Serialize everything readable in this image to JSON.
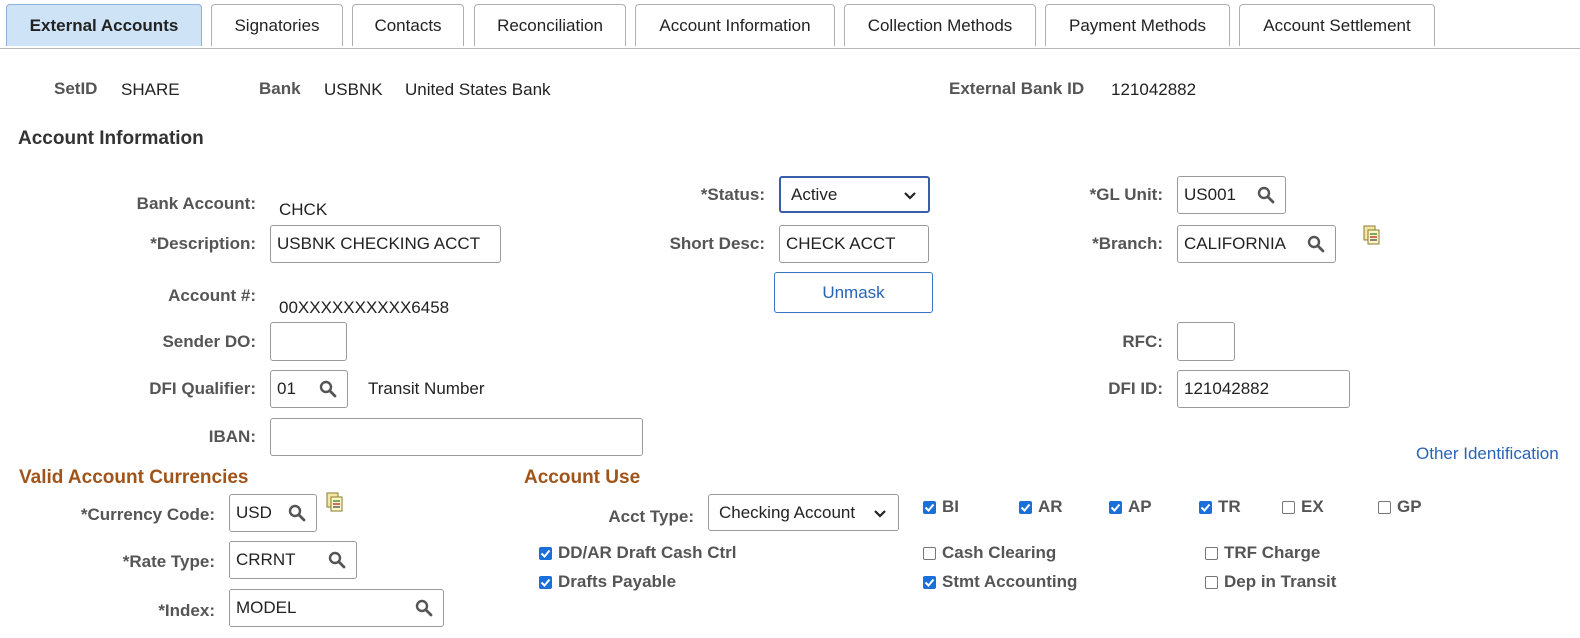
{
  "tabs": [
    {
      "label": "External Accounts",
      "active": true
    },
    {
      "label": "Signatories",
      "active": false
    },
    {
      "label": "Contacts",
      "active": false
    },
    {
      "label": "Reconciliation",
      "active": false
    },
    {
      "label": "Account Information",
      "active": false
    },
    {
      "label": "Collection Methods",
      "active": false
    },
    {
      "label": "Payment Methods",
      "active": false
    },
    {
      "label": "Account Settlement",
      "active": false
    }
  ],
  "header": {
    "setid_label": "SetID",
    "setid_value": "SHARE",
    "bank_label": "Bank",
    "bank_code": "USBNK",
    "bank_name": "United States Bank",
    "ext_bank_id_label": "External Bank ID",
    "ext_bank_id_value": "121042882"
  },
  "account_info": {
    "title": "Account Information",
    "bank_account_label": "Bank Account:",
    "bank_account_value": "CHCK",
    "description_label": "*Description:",
    "description_value": "USBNK CHECKING ACCT",
    "account_num_label": "Account #:",
    "account_num_value": "00XXXXXXXXXX6458",
    "sender_do_label": "Sender DO:",
    "sender_do_value": "",
    "dfi_qualifier_label": "DFI Qualifier:",
    "dfi_qualifier_value": "01",
    "dfi_qualifier_desc": "Transit Number",
    "iban_label": "IBAN:",
    "iban_value": "",
    "status_label": "*Status:",
    "status_value": "Active",
    "short_desc_label": "Short Desc:",
    "short_desc_value": "CHECK ACCT",
    "unmask_label": "Unmask",
    "gl_unit_label": "*GL Unit:",
    "gl_unit_value": "US001",
    "branch_label": "*Branch:",
    "branch_value": "CALIFORNIA",
    "rfc_label": "RFC:",
    "rfc_value": "",
    "dfi_id_label": "DFI ID:",
    "dfi_id_value": "121042882",
    "other_id_link": "Other Identification"
  },
  "currencies": {
    "title": "Valid Account Currencies",
    "currency_code_label": "*Currency Code:",
    "currency_code_value": "USD",
    "rate_type_label": "*Rate Type:",
    "rate_type_value": "CRRNT",
    "index_label": "*Index:",
    "index_value": "MODEL"
  },
  "account_use": {
    "title": "Account Use",
    "acct_type_label": "Acct Type:",
    "acct_type_value": "Checking Account",
    "checks": [
      {
        "label": "BI",
        "checked": true
      },
      {
        "label": "AR",
        "checked": true
      },
      {
        "label": "AP",
        "checked": true
      },
      {
        "label": "TR",
        "checked": true
      },
      {
        "label": "EX",
        "checked": false
      },
      {
        "label": "GP",
        "checked": false
      },
      {
        "label": "DD/AR Draft Cash Ctrl",
        "checked": true
      },
      {
        "label": "Cash Clearing",
        "checked": false
      },
      {
        "label": "TRF Charge",
        "checked": false
      },
      {
        "label": "Drafts Payable",
        "checked": true
      },
      {
        "label": "Stmt Accounting",
        "checked": true
      },
      {
        "label": "Dep in Transit",
        "checked": false
      }
    ]
  }
}
